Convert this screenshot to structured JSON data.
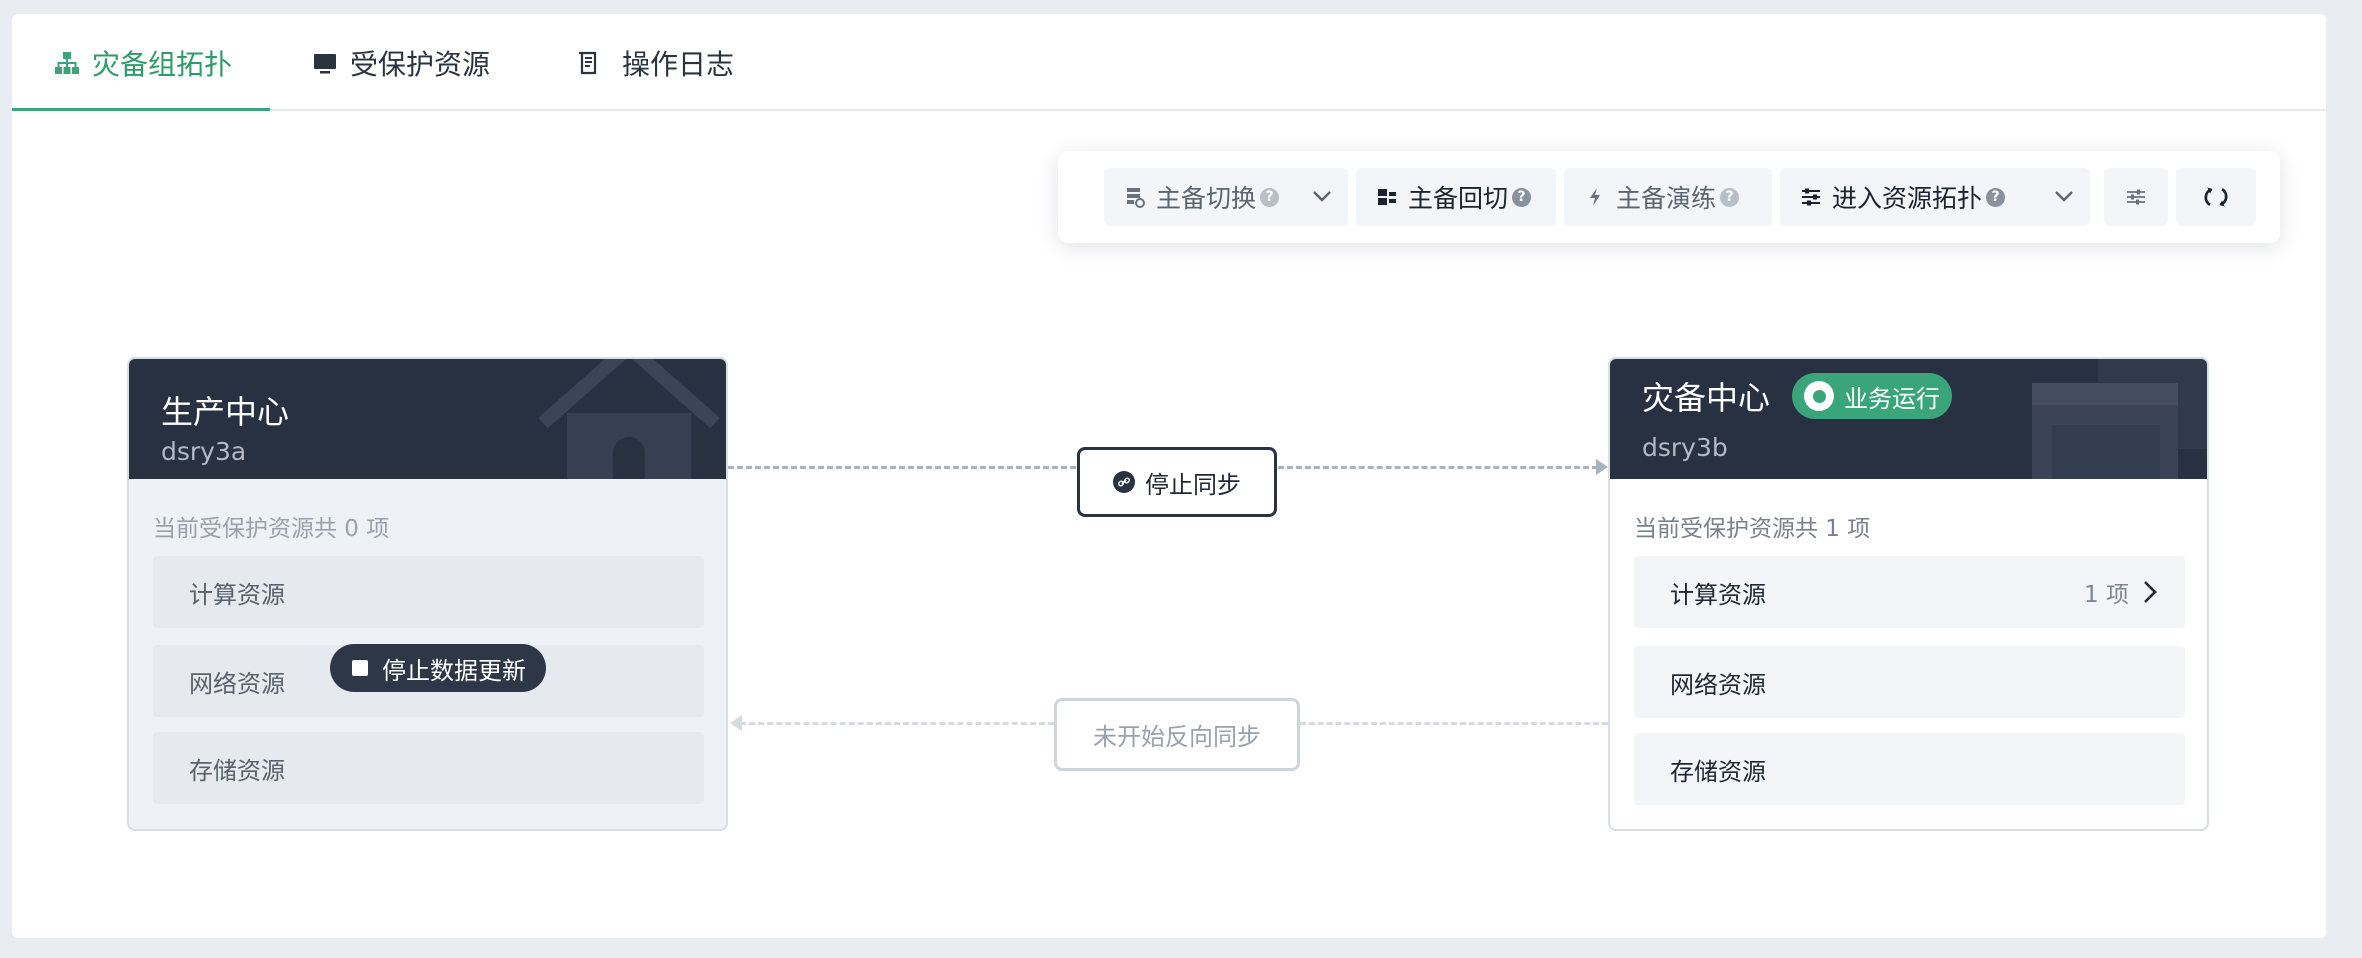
{
  "tabs": [
    {
      "label": "灾备组拓扑",
      "icon": "topology-icon",
      "active": true
    },
    {
      "label": "受保护资源",
      "icon": "monitor-icon",
      "active": false
    },
    {
      "label": "操作日志",
      "icon": "log-icon",
      "active": false
    }
  ],
  "toolbar": {
    "switchover": {
      "label": "主备切换",
      "icon": "switchover-icon"
    },
    "switchback": {
      "label": "主备回切",
      "icon": "switchback-icon"
    },
    "drill": {
      "label": "主备演练",
      "icon": "lightning-icon"
    },
    "enter_topology": {
      "label": "进入资源拓扑",
      "icon": "sliders-icon"
    },
    "help_glyph": "?"
  },
  "production": {
    "title": "生产中心",
    "subtitle": "dsry3a",
    "count_text": "当前受保护资源共 0 项",
    "resources": [
      {
        "label": "计算资源"
      },
      {
        "label": "网络资源"
      },
      {
        "label": "存储资源"
      }
    ],
    "stop_update_label": "停止数据更新"
  },
  "disaster": {
    "title": "灾备中心",
    "subtitle": "dsry3b",
    "status": "业务运行",
    "count_text": "当前受保护资源共 1 项",
    "resources": [
      {
        "label": "计算资源",
        "count": "1 项"
      },
      {
        "label": "网络资源"
      },
      {
        "label": "存储资源"
      }
    ]
  },
  "sync": {
    "forward_label": "停止同步",
    "reverse_label": "未开始反向同步"
  },
  "colors": {
    "accent": "#3aa57a",
    "card_header": "#283142",
    "background": "#e9edf2"
  }
}
